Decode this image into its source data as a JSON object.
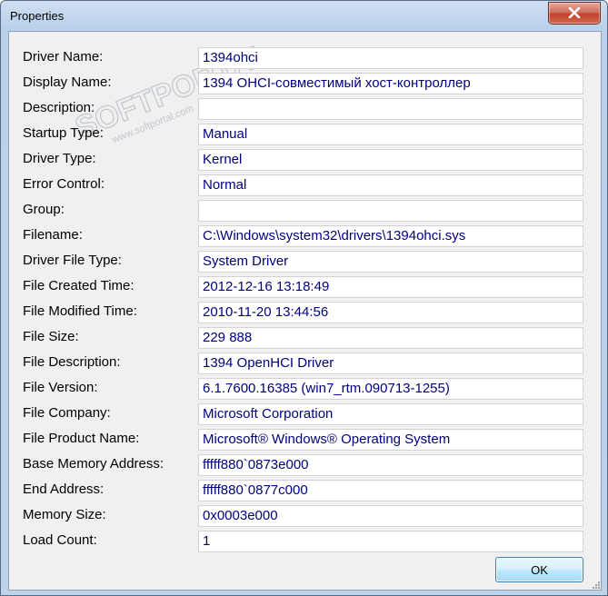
{
  "window": {
    "title": "Properties",
    "watermark_text": "SOFTPORTAL",
    "watermark_url": "www.softportal.com"
  },
  "properties": [
    {
      "label": "Driver Name:",
      "value": "1394ohci"
    },
    {
      "label": "Display Name:",
      "value": "1394 OHCI-совместимый хост-контроллер"
    },
    {
      "label": "Description:",
      "value": ""
    },
    {
      "label": "Startup Type:",
      "value": "Manual"
    },
    {
      "label": "Driver Type:",
      "value": "Kernel"
    },
    {
      "label": "Error Control:",
      "value": "Normal"
    },
    {
      "label": "Group:",
      "value": ""
    },
    {
      "label": "Filename:",
      "value": "C:\\Windows\\system32\\drivers\\1394ohci.sys"
    },
    {
      "label": "Driver File Type:",
      "value": "System Driver"
    },
    {
      "label": "File Created Time:",
      "value": "2012-12-16 13:18:49"
    },
    {
      "label": "File Modified Time:",
      "value": "2010-11-20 13:44:56"
    },
    {
      "label": "File Size:",
      "value": "229 888"
    },
    {
      "label": "File Description:",
      "value": "1394 OpenHCI Driver"
    },
    {
      "label": "File Version:",
      "value": "6.1.7600.16385 (win7_rtm.090713-1255)"
    },
    {
      "label": "File Company:",
      "value": "Microsoft Corporation"
    },
    {
      "label": "File Product Name:",
      "value": "Microsoft® Windows® Operating System"
    },
    {
      "label": "Base Memory Address:",
      "value": "fffff880`0873e000"
    },
    {
      "label": "End Address:",
      "value": "fffff880`0877c000"
    },
    {
      "label": "Memory Size:",
      "value": "0x0003e000"
    },
    {
      "label": "Load Count:",
      "value": "1"
    }
  ],
  "buttons": {
    "ok_label": "OK"
  }
}
